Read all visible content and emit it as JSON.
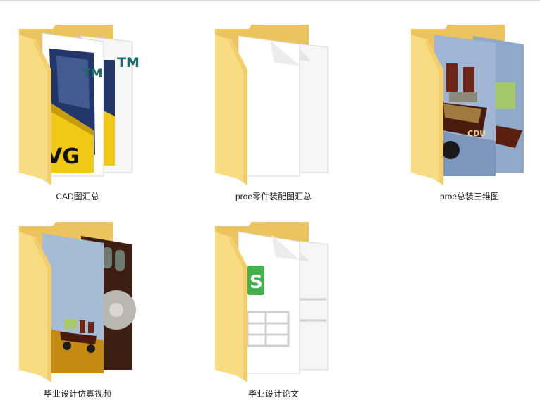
{
  "folders": [
    {
      "label": "CAD图汇总",
      "thumb": "dwg-file-icon",
      "brand_text": "TM",
      "ext_text": "VG"
    },
    {
      "label": "proe零件装配图汇总",
      "thumb": "blank-document-icon"
    },
    {
      "label": "proe总装三维图",
      "thumb": "3d-assembly-render-icon",
      "render_text": "CDU"
    },
    {
      "label": "毕业设计仿真视频",
      "thumb": "simulation-video-icon"
    },
    {
      "label": "毕业设计论文",
      "thumb": "spreadsheet-document-icon",
      "doc_letter": "S"
    }
  ],
  "colors": {
    "folder_back": "#ebc35f",
    "folder_front": "#f8dc84",
    "dwg_blue": "#23366b",
    "dwg_yellow": "#f0c917",
    "sheet_green": "#3fb24a",
    "render_blue": "#90a8c9"
  }
}
